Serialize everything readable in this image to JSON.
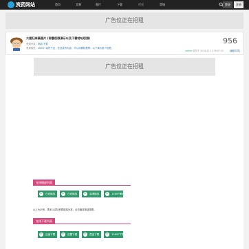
{
  "header": {
    "site_name": "资药网站",
    "nav": [
      "首页",
      "文章",
      "图片",
      "下载",
      "视频",
      "商城"
    ],
    "login_label": "登录",
    "register_label": "注册"
  },
  "ads": {
    "top": "广告位正在招租",
    "inner": "广告位正在招租"
  },
  "post": {
    "title": "大图归来高图片 (观看权限演示以及下载地址权限)",
    "category_prefix": "资源分类：",
    "category": "电影/下载",
    "description_prefix": "资源描述：",
    "description": "admin 发布于此，在此发布内容，可以设置权限等，以下演示各个权限。",
    "views": "956",
    "meta_tag": "admin",
    "meta_date": "发布于 2016-02-11 09:07:32",
    "edit_label": "[编辑文章]"
  },
  "sections": {
    "online_label": "在线播放列表",
    "online_buttons": [
      "在线播放",
      "在线播放",
      "高清播放",
      "1080P播放"
    ],
    "notice": "以上为示例，具体以实际资源链接为准，点击播放按钮观看。",
    "download_label": "在线下载列表",
    "download_buttons": [
      "百度下载",
      "迅雷下载",
      "直连下载",
      "1080P下载"
    ]
  },
  "colors": {
    "topbar": "#222222",
    "accent_pink": "#d64a7d",
    "button_green": "#2e9a6a",
    "logo_blue": "#2aa0d8"
  }
}
